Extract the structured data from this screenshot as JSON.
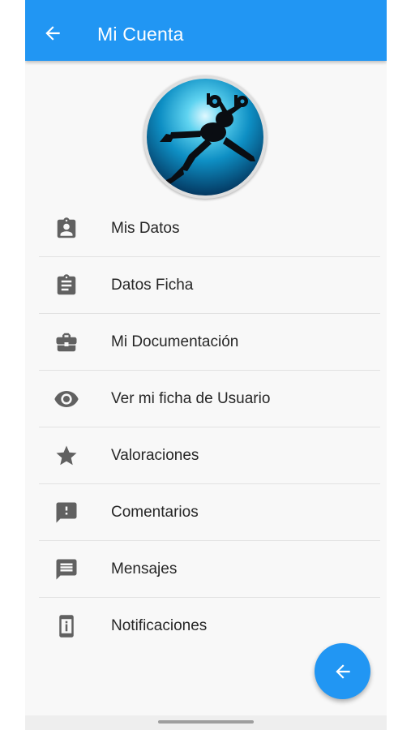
{
  "app_bar": {
    "title": "Mi Cuenta",
    "color": "#2196f3",
    "back_icon": "arrow-left-icon"
  },
  "profile": {
    "avatar": "scuba-diver-photo"
  },
  "menu": {
    "items": [
      {
        "label": "Mis Datos",
        "icon": "account-box-icon"
      },
      {
        "label": "Datos Ficha",
        "icon": "clipboard-icon"
      },
      {
        "label": "Mi Documentación",
        "icon": "briefcase-icon"
      },
      {
        "label": "Ver mi ficha de Usuario",
        "icon": "eye-icon"
      },
      {
        "label": "Valoraciones",
        "icon": "star-icon"
      },
      {
        "label": "Comentarios",
        "icon": "feedback-icon"
      },
      {
        "label": "Mensajes",
        "icon": "message-icon"
      },
      {
        "label": "Notificaciones",
        "icon": "info-device-icon"
      }
    ]
  },
  "fab": {
    "icon": "arrow-left-icon",
    "color": "#2196f3"
  }
}
